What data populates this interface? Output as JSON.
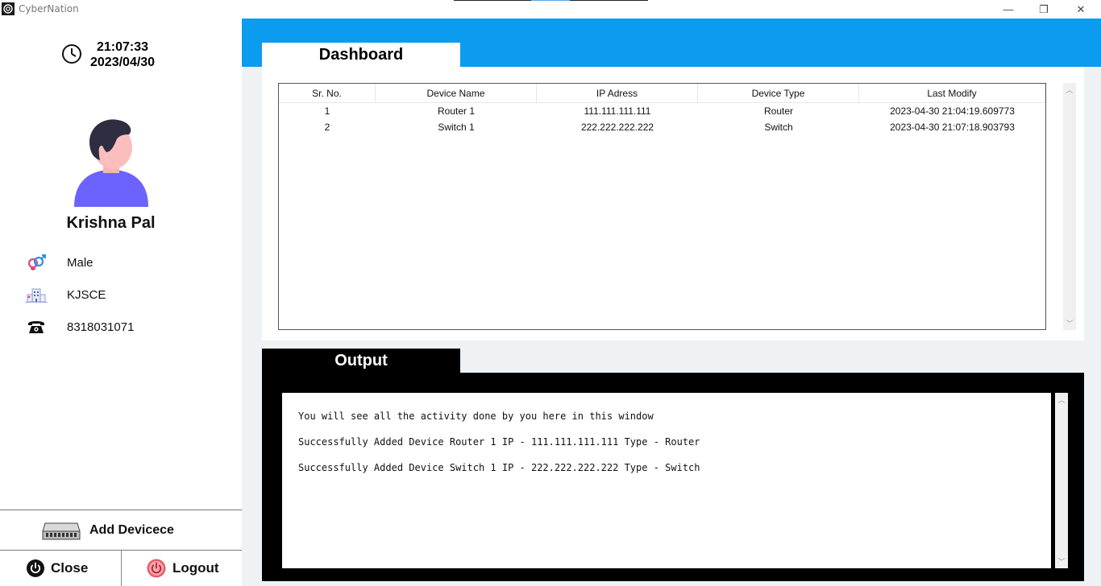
{
  "window": {
    "title": "CyberNation",
    "minimize": "—",
    "restore": "❐",
    "close": "✕"
  },
  "sidebar": {
    "time": "21:07:33",
    "date": "2023/04/30",
    "user_name": "Krishna Pal",
    "gender": "Male",
    "college": "KJSCE",
    "phone": "8318031071",
    "add_device_label": "Add Devicece",
    "close_label": "Close",
    "logout_label": "Logout"
  },
  "dashboard": {
    "tab_label": "Dashboard",
    "columns": [
      "Sr. No.",
      "Device Name",
      "IP Adress",
      "Device Type",
      "Last Modify"
    ],
    "rows": [
      [
        "1",
        "Router 1",
        "111.111.111.111",
        "Router",
        "2023-04-30 21:04:19.609773"
      ],
      [
        "2",
        "Switch 1",
        "222.222.222.222",
        "Switch",
        "2023-04-30 21:07:18.903793"
      ]
    ]
  },
  "output": {
    "tab_label": "Output",
    "lines": [
      "You will see all the activity done by you here in this window",
      "Successfully Added Device Router 1 IP - 111.111.111.111 Type - Router",
      "Successfully Added Device Switch 1 IP - 222.222.222.222 Type - Switch"
    ]
  },
  "colors": {
    "accent_blue": "#0b9bef",
    "avatar_shirt": "#6c63ff",
    "avatar_hair": "#2f2e41",
    "logout_red": "#e35d6a"
  }
}
